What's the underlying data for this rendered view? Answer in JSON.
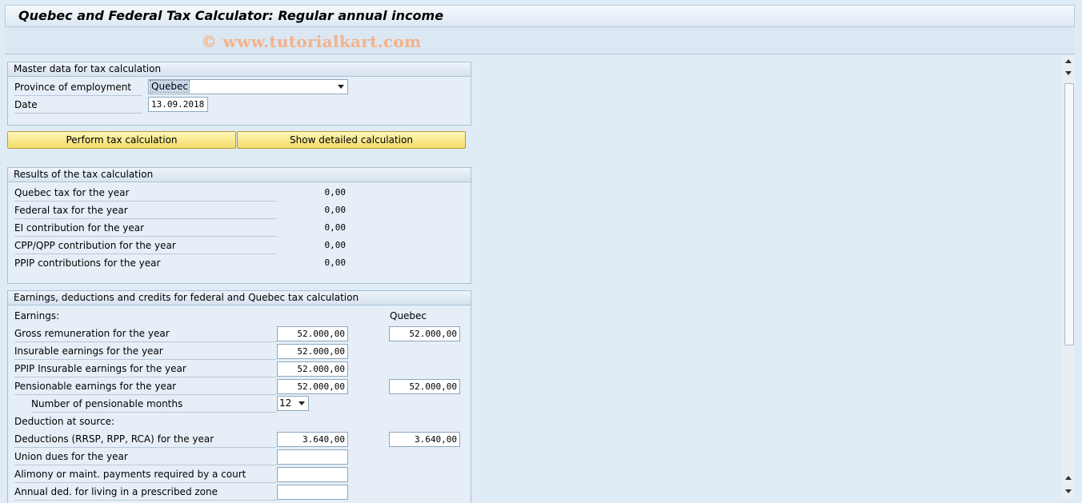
{
  "window": {
    "title": "Quebec and Federal Tax Calculator: Regular annual income",
    "watermark": "© www.tutorialkart.com"
  },
  "master": {
    "heading": "Master data for tax calculation",
    "province_label": "Province of employment",
    "province_value": "Quebec",
    "date_label": "Date",
    "date_value": "13.09.2018"
  },
  "actions": {
    "perform": "Perform tax calculation",
    "show_detailed": "Show detailed calculation"
  },
  "results": {
    "heading": "Results of the tax calculation",
    "rows": [
      {
        "label": "Quebec tax for the year",
        "value": "0,00"
      },
      {
        "label": "Federal tax for the year",
        "value": "0,00"
      },
      {
        "label": "EI contribution for the year",
        "value": "0,00"
      },
      {
        "label": "CPP/QPP contribution for the year",
        "value": "0,00"
      },
      {
        "label": "PPIP contributions for the year",
        "value": "0,00"
      }
    ]
  },
  "earnings": {
    "heading": "Earnings, deductions and credits for federal and Quebec tax calculation",
    "earnings_label": "Earnings:",
    "quebec_col": "Quebec",
    "gross_label": "Gross remuneration for the year",
    "gross_federal": "52.000,00",
    "gross_quebec": "52.000,00",
    "insurable_label": "Insurable earnings for the year",
    "insurable_federal": "52.000,00",
    "ppip_label": "PPIP Insurable earnings for the year",
    "ppip_federal": "52.000,00",
    "pensionable_label": "Pensionable earnings for the year",
    "pensionable_federal": "52.000,00",
    "pensionable_quebec": "52.000,00",
    "months_label": "Number of pensionable months",
    "months_value": "12",
    "deduction_label": "Deduction at source:",
    "rrsp_label": "Deductions (RRSP, RPP, RCA) for the year",
    "rrsp_federal": "3.640,00",
    "rrsp_quebec": "3.640,00",
    "union_label": "Union dues for the year",
    "union_federal": "",
    "alimony_label": "Alimony or maint. payments required by a court",
    "alimony_federal": "",
    "zone_label": "Annual ded. for living in a prescribed zone",
    "zone_federal": ""
  },
  "icons": {
    "scroll_up": "arrow-up-icon",
    "scroll_down": "arrow-down-icon",
    "dropdown": "chevron-down-icon"
  }
}
